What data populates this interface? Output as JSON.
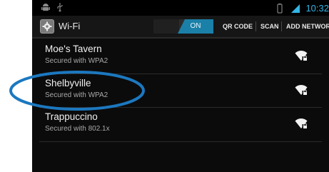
{
  "status_bar": {
    "time": "10:32",
    "accent": "#33b5e5",
    "icons": [
      "android-debug-icon",
      "usb-icon",
      "battery-icon",
      "wifi-status-icon"
    ]
  },
  "action_bar": {
    "title": "Wi-Fi",
    "app_icon": "settings-gear-icon",
    "toggle": {
      "label": "ON",
      "state": "on",
      "color": "#1b80a8"
    },
    "actions": [
      "QR CODE",
      "SCAN",
      "ADD NETWORK"
    ]
  },
  "networks": [
    {
      "name": "Moe's Tavern",
      "security": "Secured with WPA2",
      "icon": "wifi-secured-signal-icon"
    },
    {
      "name": "Shelbyville",
      "security": "Secured with WPA2",
      "icon": "wifi-secured-signal-icon",
      "highlighted": true
    },
    {
      "name": "Trappuccino",
      "security": "Secured with 802.1x",
      "icon": "wifi-secured-signal-icon"
    }
  ],
  "colors": {
    "background": "#0b0b0c",
    "highlight_ring": "#1c78bf",
    "primary_text": "#f0f0f0",
    "secondary_text": "#a9a9a9"
  }
}
